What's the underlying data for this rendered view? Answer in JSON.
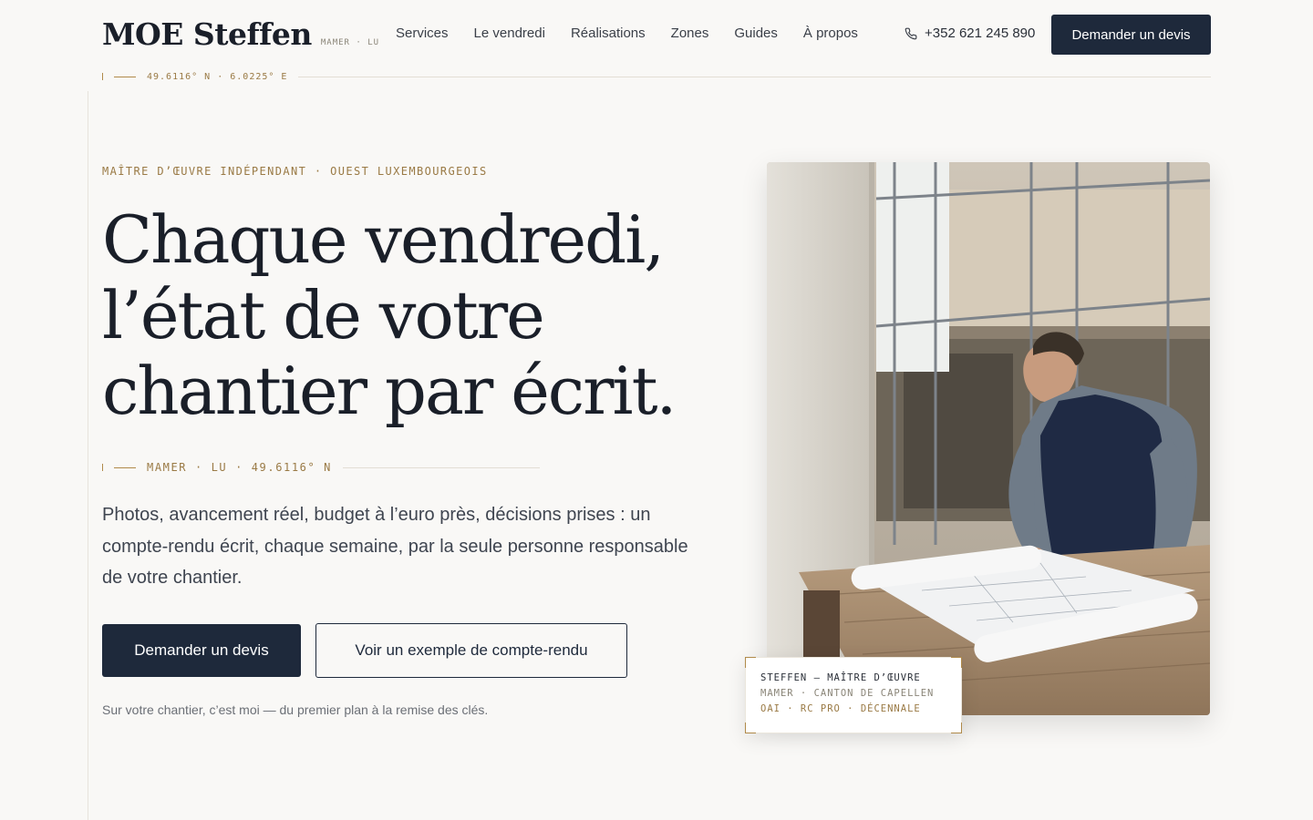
{
  "header": {
    "brand": "MOE Steffen",
    "brand_location": "MAMER · LU",
    "nav": [
      "Services",
      "Le vendredi",
      "Réalisations",
      "Zones",
      "Guides",
      "À propos"
    ],
    "phone": "+352 621 245 890",
    "cta": "Demander un devis",
    "coordinates": "49.6116° N · 6.0225° E"
  },
  "hero": {
    "eyebrow": "MAÎTRE D’ŒUVRE INDÉPENDANT · OUEST LUXEMBOURGEOIS",
    "title_lines": [
      "Chaque vendredi,",
      "l’état de votre",
      "chantier par écrit."
    ],
    "location": "MAMER · LU · 49.6116° N",
    "lead": "Photos, avancement réel, budget à l’euro près, décisions prises : un compte-rendu écrit, chaque semaine, par la seule personne responsable de votre chantier.",
    "primary_cta": "Demander un devis",
    "secondary_cta": "Voir un exemple de compte-rendu",
    "note": "Sur votre chantier, c’est moi — du premier plan à la remise des clés."
  },
  "card": {
    "line1": "STEFFEN — MAÎTRE D’ŒUVRE",
    "line2": "MAMER · CANTON DE CAPELLEN",
    "line3": "OAI · RC PRO · DÉCENNALE"
  },
  "colors": {
    "navy": "#1e293b",
    "accent_gold": "#9a7a45",
    "background": "#f9f8f6"
  }
}
